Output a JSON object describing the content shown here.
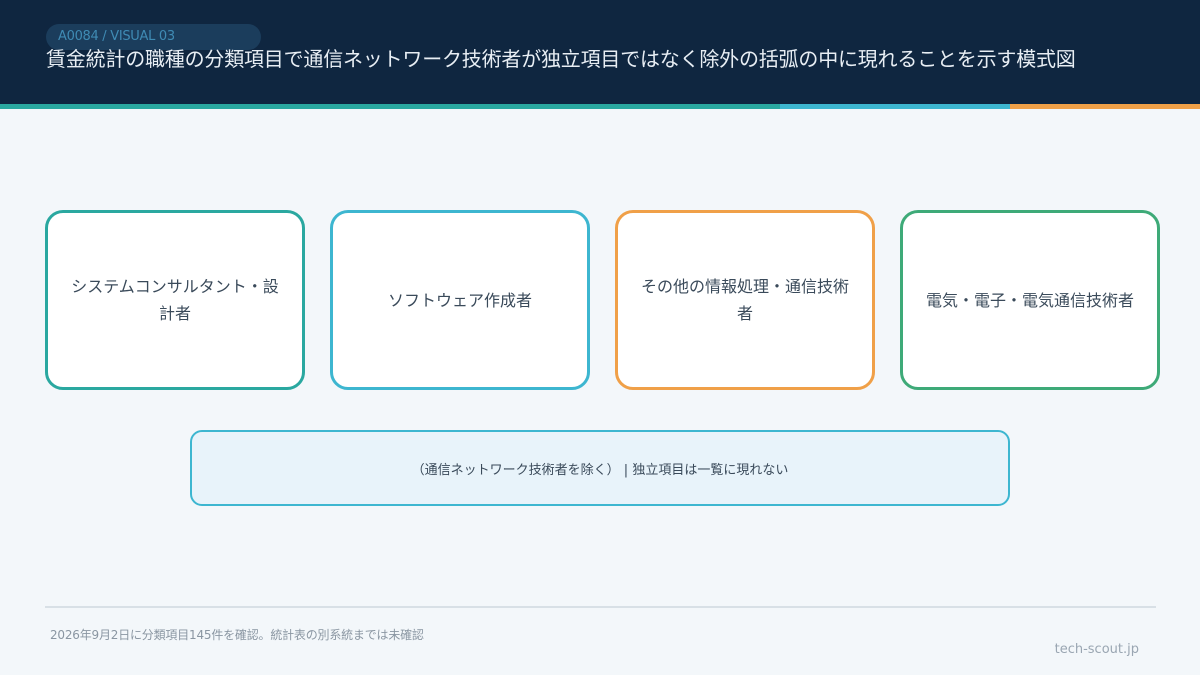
{
  "header": {
    "tag": "A0084 / VISUAL 03",
    "title": "賃金統計の職種の分類項目で通信ネットワーク技術者が独立項目ではなく除外の括弧の中に現れることを示す模式図"
  },
  "categories": [
    {
      "label": "システムコンサルタント・設計者"
    },
    {
      "label": "ソフトウェア作成者"
    },
    {
      "label": "その他の情報処理・通信技術者"
    },
    {
      "label": "電気・電子・電気通信技術者"
    }
  ],
  "exclusion": {
    "text": "（通信ネットワーク技術者を除く） | 独立項目は一覧に現れない"
  },
  "footer": {
    "note": "2026年9月2日に分類項目145件を確認。統計表の別系統までは未確認",
    "brand": "tech-scout.jp"
  },
  "colors": {
    "header_bg": "#0f2640",
    "teal": "#2aa8a0",
    "cyan": "#3db6d0",
    "orange": "#f0a048",
    "green": "#3eaa78"
  }
}
